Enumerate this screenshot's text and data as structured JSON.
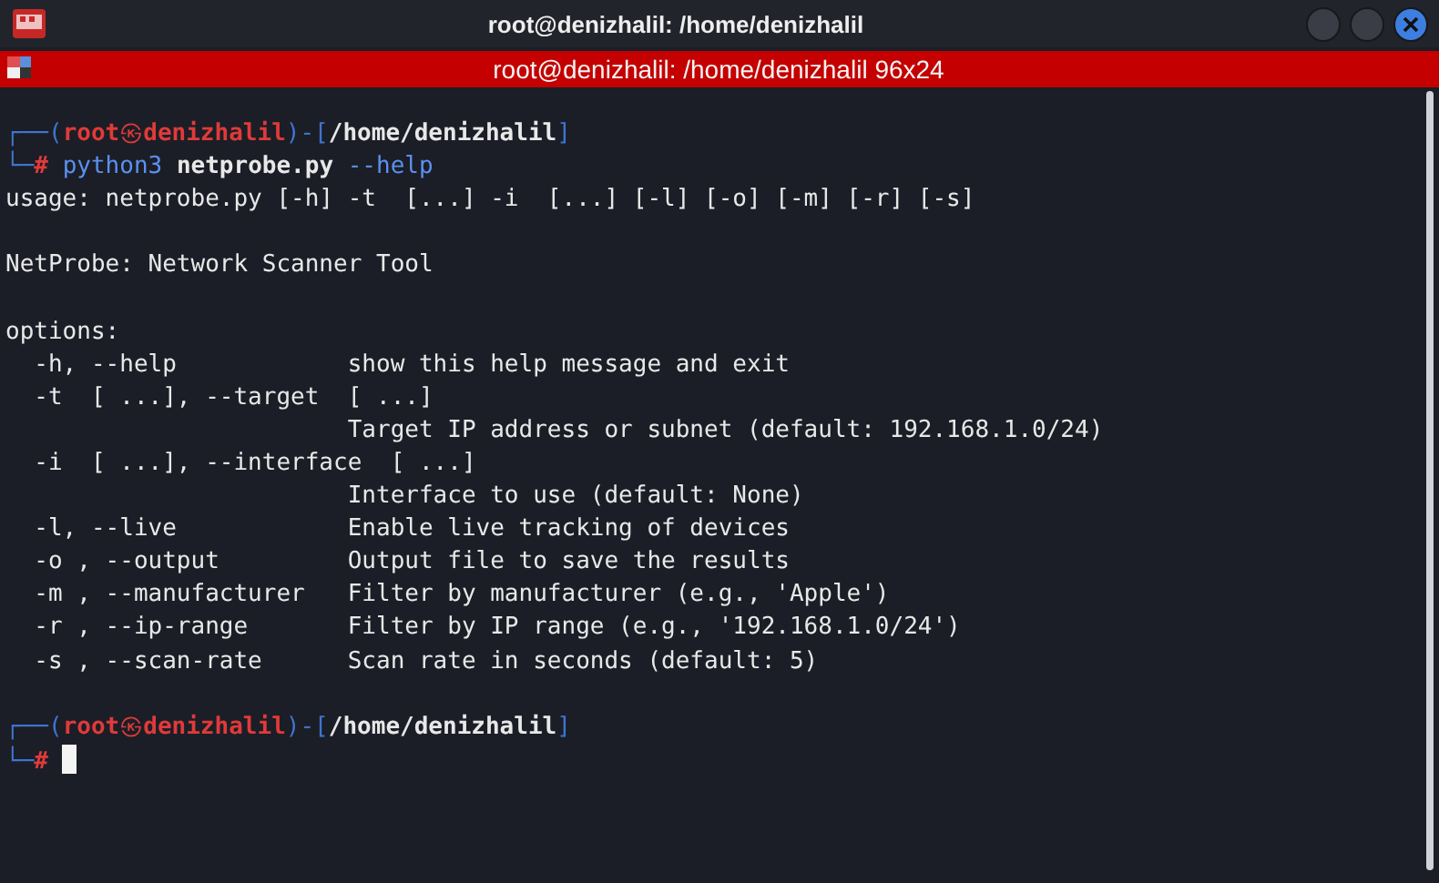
{
  "window": {
    "title": "root@denizhalil: /home/denizhalil"
  },
  "tab": {
    "title": "root@denizhalil: /home/denizhalil 96x24"
  },
  "lines": [
    {
      "kind": "prompt",
      "open": "┌──(",
      "user": "root",
      "at": "㉿",
      "host": "denizhalil",
      "mid": ")-[",
      "path": "/home/denizhalil",
      "close": "]"
    },
    {
      "kind": "command",
      "corner": "└─",
      "hash": "#",
      "program": "python3",
      "script": "netprobe.py",
      "args": "--help"
    },
    {
      "kind": "output",
      "text": "usage: netprobe.py [-h] -t  [...] -i  [...] [-l] [-o] [-m] [-r] [-s]"
    },
    {
      "kind": "blank"
    },
    {
      "kind": "output",
      "text": "NetProbe: Network Scanner Tool"
    },
    {
      "kind": "blank"
    },
    {
      "kind": "output",
      "text": "options:"
    },
    {
      "kind": "output",
      "text": "  -h, --help            show this help message and exit"
    },
    {
      "kind": "output",
      "text": "  -t  [ ...], --target  [ ...]"
    },
    {
      "kind": "output",
      "text": "                        Target IP address or subnet (default: 192.168.1.0/24)"
    },
    {
      "kind": "output",
      "text": "  -i  [ ...], --interface  [ ...]"
    },
    {
      "kind": "output",
      "text": "                        Interface to use (default: None)"
    },
    {
      "kind": "output",
      "text": "  -l, --live            Enable live tracking of devices"
    },
    {
      "kind": "output",
      "text": "  -o , --output         Output file to save the results"
    },
    {
      "kind": "output",
      "text": "  -m , --manufacturer   Filter by manufacturer (e.g., 'Apple')"
    },
    {
      "kind": "output",
      "text": "  -r , --ip-range       Filter by IP range (e.g., '192.168.1.0/24')"
    },
    {
      "kind": "output",
      "text": "  -s , --scan-rate      Scan rate in seconds (default: 5)"
    },
    {
      "kind": "blank"
    },
    {
      "kind": "prompt",
      "open": "┌──(",
      "user": "root",
      "at": "㉿",
      "host": "denizhalil",
      "mid": ")-[",
      "path": "/home/denizhalil",
      "close": "]"
    },
    {
      "kind": "input",
      "corner": "└─",
      "hash": "#",
      "cursor": true
    }
  ]
}
